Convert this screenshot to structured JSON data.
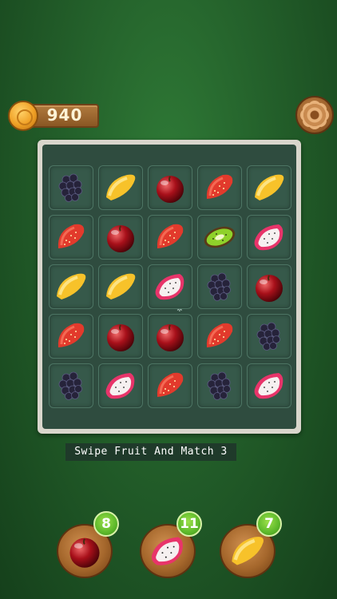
{
  "hud": {
    "coins": "940",
    "coin_icon": "coin-icon",
    "settings_icon": "gear-icon"
  },
  "board": {
    "rows": 5,
    "cols": 5,
    "grid": [
      [
        "blackberry",
        "orange-slice",
        "cherry",
        "strawberry",
        "orange-slice"
      ],
      [
        "strawberry",
        "cherry",
        "strawberry",
        "kiwi",
        "dragonfruit"
      ],
      [
        "orange-slice",
        "orange-slice",
        "dragonfruit",
        "blackberry",
        "cherry"
      ],
      [
        "strawberry",
        "cherry",
        "cherry",
        "strawberry",
        "blackberry"
      ],
      [
        "blackberry",
        "dragonfruit",
        "strawberry",
        "blackberry",
        "dragonfruit"
      ]
    ]
  },
  "hint": "Swipe Fruit And Match 3",
  "goals": [
    {
      "fruit": "cherry",
      "count": "8"
    },
    {
      "fruit": "dragonfruit",
      "count": "11"
    },
    {
      "fruit": "orange-slice",
      "count": "7"
    }
  ],
  "colors": {
    "background": "#235f2a",
    "board_frame": "#d9d6cc",
    "board_fill": "#2f4c3f",
    "badge_green": "#5cb82a"
  }
}
